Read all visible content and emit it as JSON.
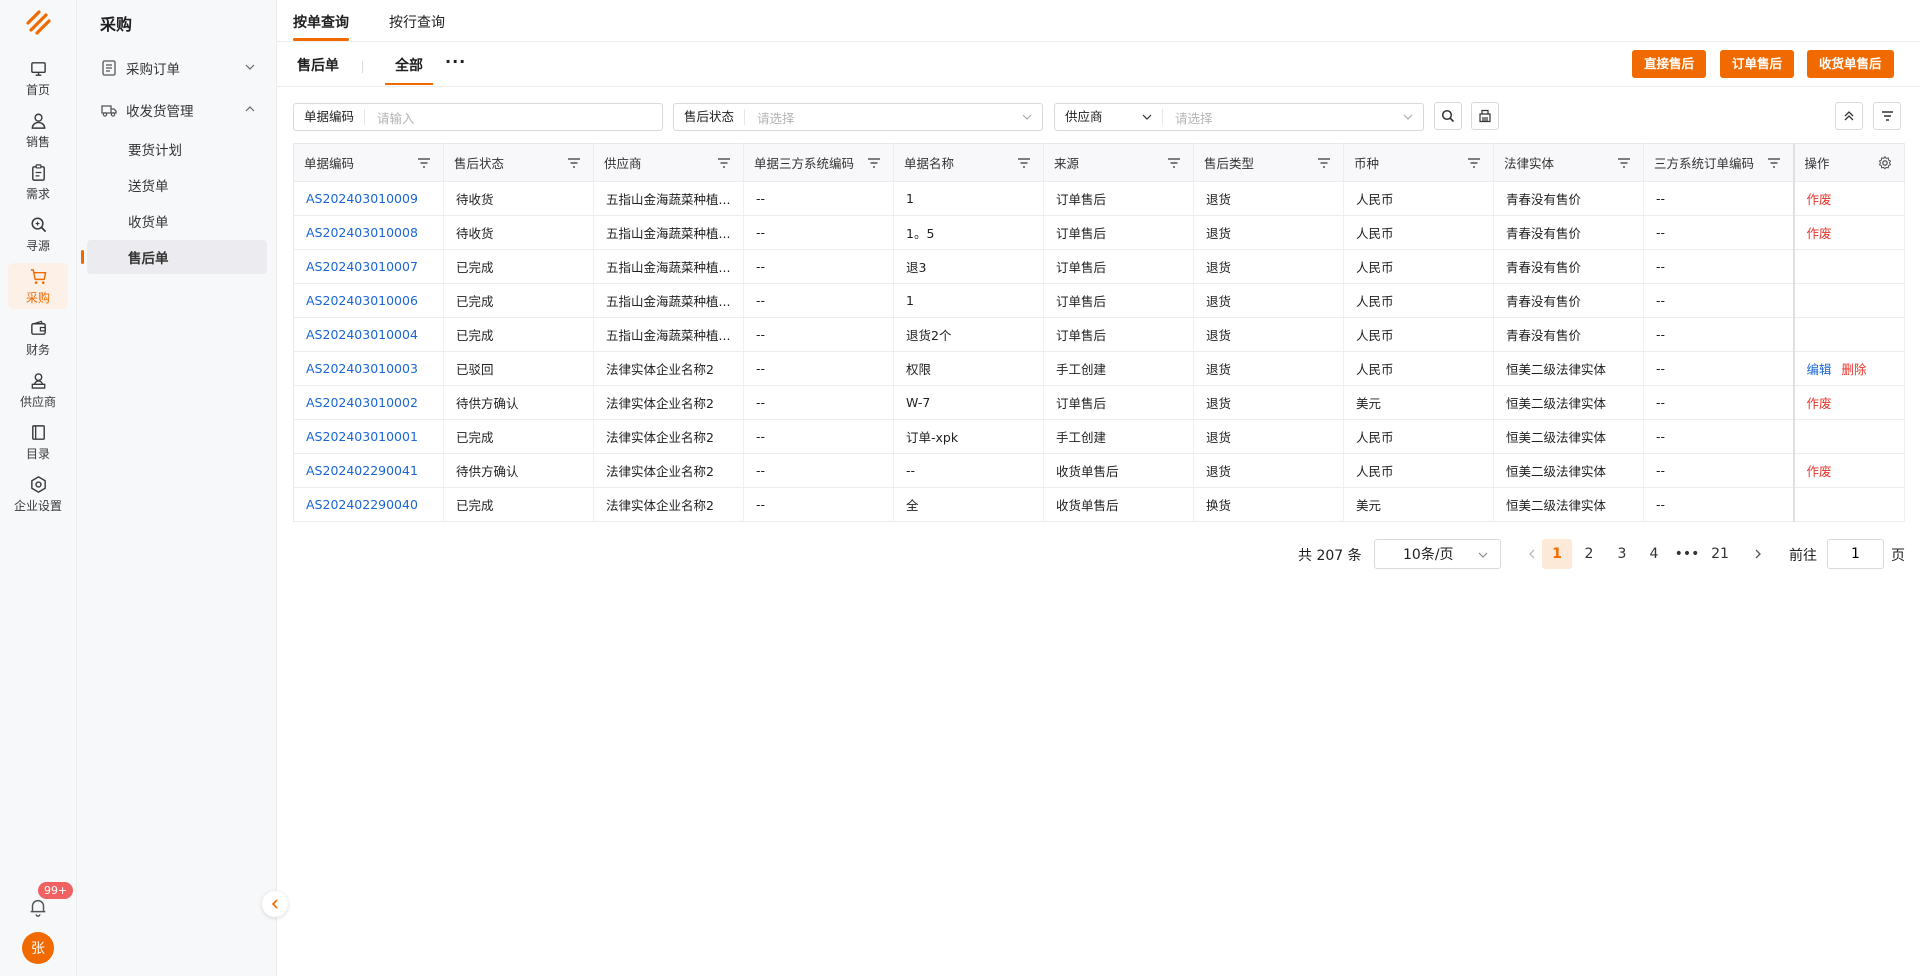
{
  "rail": {
    "items": [
      {
        "label": "首页",
        "icon": "monitor-icon"
      },
      {
        "label": "销售",
        "icon": "user-icon"
      },
      {
        "label": "需求",
        "icon": "clipboard-icon"
      },
      {
        "label": "寻源",
        "icon": "search-icon"
      },
      {
        "label": "采购",
        "icon": "cart-icon",
        "active": true
      },
      {
        "label": "财务",
        "icon": "wallet-icon"
      },
      {
        "label": "供应商",
        "icon": "supplier-icon"
      },
      {
        "label": "目录",
        "icon": "book-icon"
      },
      {
        "label": "企业设置",
        "icon": "settings-icon"
      }
    ],
    "badge": "99+",
    "avatar": "张"
  },
  "menu": {
    "title": "采购",
    "groups": [
      {
        "label": "采购订单",
        "icon": "order-icon",
        "expanded": false
      },
      {
        "label": "收发货管理",
        "icon": "truck-icon",
        "expanded": true
      }
    ],
    "subitems": [
      "要货计划",
      "送货单",
      "收货单",
      "售后单"
    ],
    "active_subitem": "售后单"
  },
  "tabs": {
    "by_order": "按单查询",
    "by_line": "按行查询"
  },
  "subbar": {
    "title": "售后单",
    "tab_all": "全部",
    "more": "···",
    "buttons": {
      "direct": "直接售后",
      "order": "订单售后",
      "receipt": "收货单售后"
    }
  },
  "filters": {
    "code_label": "单据编码",
    "code_placeholder": "请输入",
    "status_label": "售后状态",
    "status_placeholder": "请选择",
    "supplier_label": "供应商",
    "supplier_placeholder": "请选择"
  },
  "table": {
    "headers": [
      "单据编码",
      "售后状态",
      "供应商",
      "单据三方系统编码",
      "单据名称",
      "来源",
      "售后类型",
      "币种",
      "法律实体",
      "三方系统订单编码",
      "操作"
    ],
    "rows": [
      {
        "code": "AS202403010009",
        "status": "待收货",
        "supplier": "五指山金海蔬菜种植...",
        "tpcode": "--",
        "name": "1",
        "source": "订单售后",
        "type": "退货",
        "currency": "人民币",
        "entity": "青春没有售价",
        "tporder": "--",
        "actions": [
          "作废"
        ]
      },
      {
        "code": "AS202403010008",
        "status": "待收货",
        "supplier": "五指山金海蔬菜种植...",
        "tpcode": "--",
        "name": "1。5",
        "source": "订单售后",
        "type": "退货",
        "currency": "人民币",
        "entity": "青春没有售价",
        "tporder": "--",
        "actions": [
          "作废"
        ]
      },
      {
        "code": "AS202403010007",
        "status": "已完成",
        "supplier": "五指山金海蔬菜种植...",
        "tpcode": "--",
        "name": "退3",
        "source": "订单售后",
        "type": "退货",
        "currency": "人民币",
        "entity": "青春没有售价",
        "tporder": "--",
        "actions": []
      },
      {
        "code": "AS202403010006",
        "status": "已完成",
        "supplier": "五指山金海蔬菜种植...",
        "tpcode": "--",
        "name": "1",
        "source": "订单售后",
        "type": "退货",
        "currency": "人民币",
        "entity": "青春没有售价",
        "tporder": "--",
        "actions": []
      },
      {
        "code": "AS202403010004",
        "status": "已完成",
        "supplier": "五指山金海蔬菜种植...",
        "tpcode": "--",
        "name": "退货2个",
        "source": "订单售后",
        "type": "退货",
        "currency": "人民币",
        "entity": "青春没有售价",
        "tporder": "--",
        "actions": []
      },
      {
        "code": "AS202403010003",
        "status": "已驳回",
        "supplier": "法律实体企业名称2",
        "tpcode": "--",
        "name": "权限",
        "source": "手工创建",
        "type": "退货",
        "currency": "人民币",
        "entity": "恒美二级法律实体",
        "tporder": "--",
        "actions": [
          "编辑",
          "删除"
        ]
      },
      {
        "code": "AS202403010002",
        "status": "待供方确认",
        "supplier": "法律实体企业名称2",
        "tpcode": "--",
        "name": "W-7",
        "source": "订单售后",
        "type": "退货",
        "currency": "美元",
        "entity": "恒美二级法律实体",
        "tporder": "--",
        "actions": [
          "作废"
        ]
      },
      {
        "code": "AS202403010001",
        "status": "已完成",
        "supplier": "法律实体企业名称2",
        "tpcode": "--",
        "name": "订单-xpk",
        "source": "手工创建",
        "type": "退货",
        "currency": "人民币",
        "entity": "恒美二级法律实体",
        "tporder": "--",
        "actions": []
      },
      {
        "code": "AS202402290041",
        "status": "待供方确认",
        "supplier": "法律实体企业名称2",
        "tpcode": "--",
        "name": "--",
        "source": "收货单售后",
        "type": "退货",
        "currency": "人民币",
        "entity": "恒美二级法律实体",
        "tporder": "--",
        "actions": [
          "作废"
        ]
      },
      {
        "code": "AS202402290040",
        "status": "已完成",
        "supplier": "法律实体企业名称2",
        "tpcode": "--",
        "name": "全",
        "source": "收货单售后",
        "type": "换货",
        "currency": "美元",
        "entity": "恒美二级法律实体",
        "tporder": "--",
        "actions": []
      }
    ]
  },
  "pagination": {
    "total": "共 207 条",
    "page_size": "10条/页",
    "pages": [
      "1",
      "2",
      "3",
      "4",
      "•••",
      "21"
    ],
    "current": "1",
    "goto_label": "前往",
    "goto_value": "1",
    "goto_suffix": "页"
  },
  "colors": {
    "accent": "#f06a00",
    "link": "#1a66d6",
    "danger": "#e5352b"
  }
}
